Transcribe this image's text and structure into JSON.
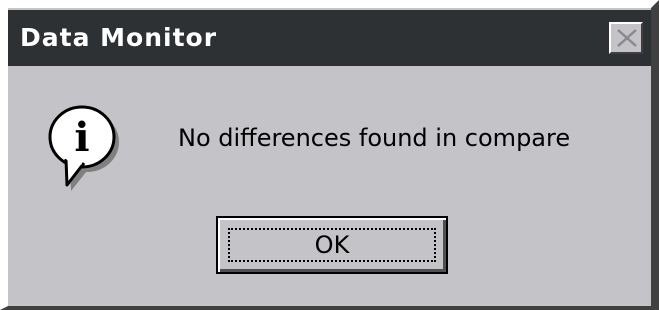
{
  "window": {
    "title": "Data Monitor",
    "close_icon": "close-icon",
    "background_color": "#c4c4c8",
    "titlebar_color": "#2e3134"
  },
  "dialog": {
    "icon": "information-icon",
    "icon_glyph": "i",
    "message": "No differences found in compare"
  },
  "buttons": {
    "ok_label": "OK"
  }
}
